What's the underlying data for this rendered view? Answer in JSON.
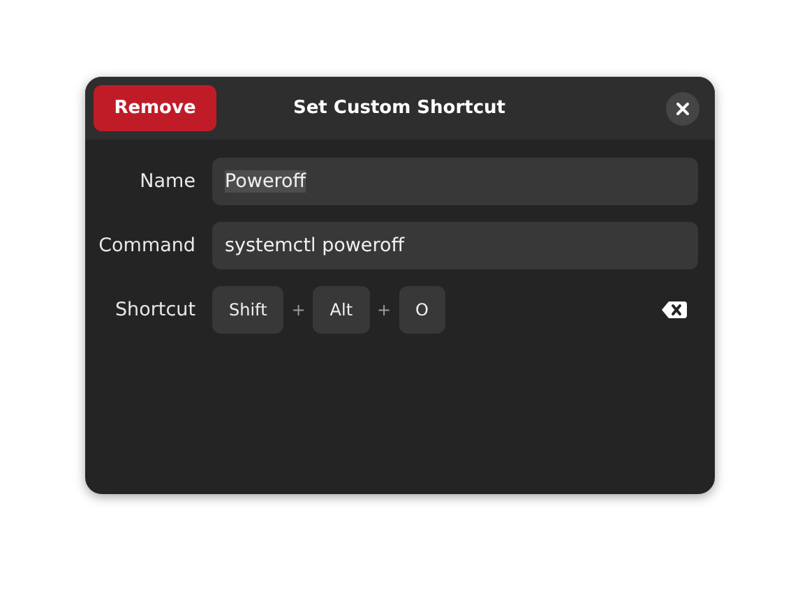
{
  "header": {
    "remove_button": "Remove",
    "title": "Set Custom Shortcut"
  },
  "fields": [
    {
      "label": "Name",
      "value": "Poweroff",
      "text_selected": true
    },
    {
      "label": "Command",
      "value": "systemctl poweroff",
      "text_selected": false
    }
  ],
  "shortcut": {
    "label": "Shortcut",
    "parts": [
      {
        "kind": "key",
        "text": "Shift"
      },
      {
        "kind": "separator",
        "text": "+"
      },
      {
        "kind": "key",
        "text": "Alt"
      },
      {
        "kind": "separator",
        "text": "+"
      },
      {
        "kind": "key",
        "text": "O"
      }
    ]
  }
}
